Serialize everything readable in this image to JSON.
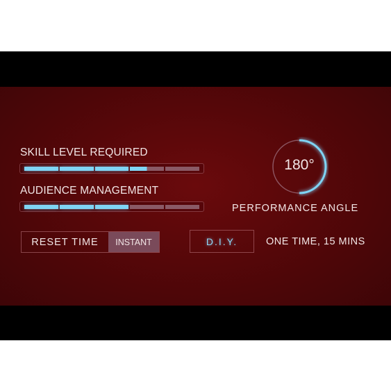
{
  "stats": [
    {
      "label": "SKILL LEVEL REQUIRED",
      "segments": 5,
      "value": 3.5
    },
    {
      "label": "AUDIENCE MANAGEMENT",
      "segments": 5,
      "value": 3
    }
  ],
  "gauge": {
    "value_label": "180°",
    "fraction": 0.5,
    "caption": "PERFORMANCE ANGLE"
  },
  "reset": {
    "label": "RESET TIME",
    "value": "INSTANT"
  },
  "diy": {
    "label": "D.I.Y.",
    "detail": "ONE TIME, 15 MINS"
  },
  "colors": {
    "accent": "#7fd4f4",
    "panel": "#5c080a"
  }
}
